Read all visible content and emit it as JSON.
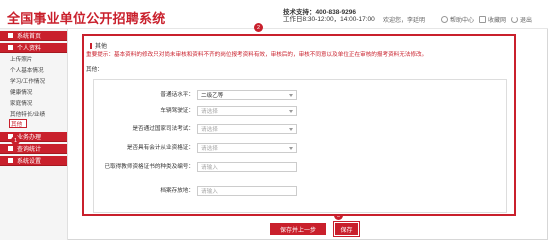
{
  "header": {
    "brand": "全国事业单位公开招聘系统",
    "hotline_line1": "技术支持：400-838-9296",
    "hotline_line2": "工作日8:30-12:00，14:00-17:00",
    "welcome": "欢迎您，李廷明",
    "help_label": "帮助中心",
    "fav_label": "收藏网",
    "logout_label": "退出"
  },
  "sidebar": {
    "home": "系统首页",
    "profile": "个人资料",
    "profile_items": [
      "上传照片",
      "个人基本情况",
      "学习/工作情况",
      "健康情况",
      "家庭情况",
      "其他特长/业绩",
      "其他"
    ],
    "business": "业务办理",
    "query": "查询统计",
    "settings": "系统设置"
  },
  "main": {
    "panel_title": "其他",
    "notice": "重要提示：基本资料的修改只对尚未审核和资料不齐的岗位报考资料有效，审核后的，审核不同意以及单位正在审核的报考资料无法修改。",
    "sub_title": "其他：",
    "fields": [
      {
        "label": "普通话水平：",
        "value": "二级乙等",
        "type": "select"
      },
      {
        "label": "车辆驾驶证：",
        "value": "请选择",
        "type": "select"
      },
      {
        "label": "是否通过国家司法考试：",
        "value": "请选择",
        "type": "select"
      },
      {
        "label": "是否具有会计从业资格证：",
        "value": "请选择",
        "type": "select"
      },
      {
        "label": "已取得教师资格证书的种类及编号：",
        "value": "请输入",
        "type": "input"
      },
      {
        "label": "档案存放地：",
        "value": "请输入",
        "type": "input"
      }
    ],
    "btn_next": "保存并上一步",
    "btn_save": "保存"
  },
  "badges": [
    "1",
    "2",
    "3"
  ],
  "colors": {
    "accent": "#c9202c"
  }
}
